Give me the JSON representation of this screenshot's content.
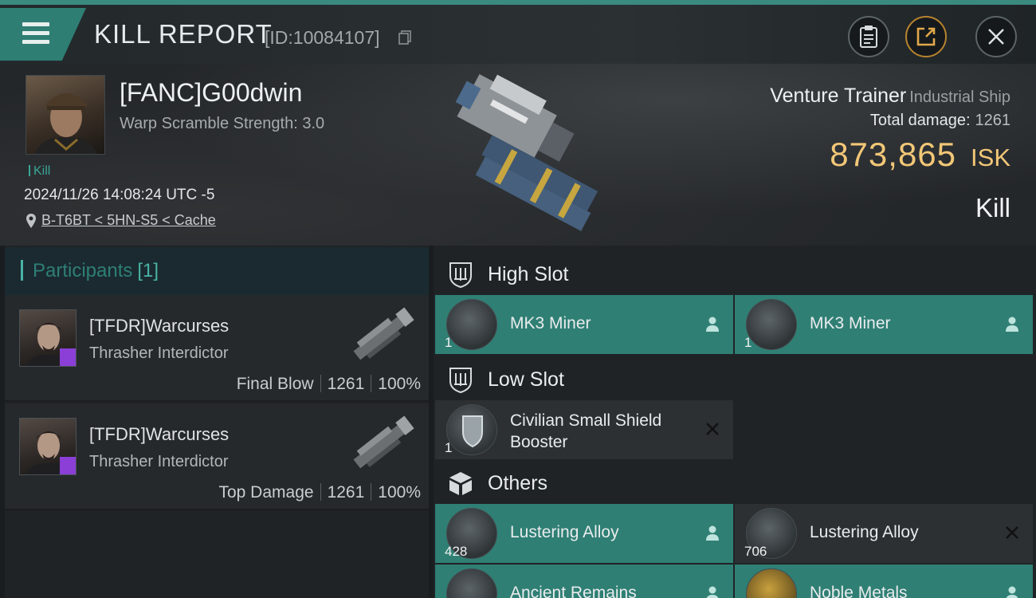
{
  "header": {
    "menu_label": "menu",
    "title": "KILL REPORT",
    "report_id": "[ID:10084107]",
    "icons": [
      "copy-icon",
      "clipboard-icon",
      "share-icon",
      "close-icon"
    ]
  },
  "victim": {
    "name": "[FANC]G00dwin",
    "subtitle": "Warp Scramble Strength: 3.0",
    "kill_tag": "Kill",
    "datetime": "2024/11/26 14:08:24 UTC -5",
    "location": "B-T6BT < 5HN-S5 < Cache"
  },
  "ship": {
    "name": "Venture Trainer",
    "class": "Industrial Ship",
    "total_damage_label": "Total damage:",
    "total_damage": "1261",
    "isk_value": "873,865",
    "isk_unit": "ISK",
    "result": "Kill"
  },
  "participants": {
    "label": "Participants",
    "count": "[1]",
    "rows": [
      {
        "name": "[TFDR]Warcurses",
        "ship": "Thrasher Interdictor",
        "role": "Final Blow",
        "damage": "1261",
        "percent": "100%"
      },
      {
        "name": "[TFDR]Warcurses",
        "ship": "Thrasher Interdictor",
        "role": "Top Damage",
        "damage": "1261",
        "percent": "100%"
      }
    ]
  },
  "slots": {
    "high": {
      "label": "High Slot",
      "items": [
        {
          "name": "MK3 Miner",
          "qty": "1",
          "status": "person-icon"
        },
        {
          "name": "MK3 Miner",
          "qty": "1",
          "status": "person-icon"
        }
      ]
    },
    "low": {
      "label": "Low Slot",
      "items": [
        {
          "name_line1": "Civilian Small Shield",
          "name_line2": "Booster",
          "qty": "1",
          "status": "destroyed-x-icon"
        }
      ]
    },
    "others": {
      "label": "Others",
      "items": [
        {
          "name": "Lustering Alloy",
          "qty": "428",
          "status": "person-icon"
        },
        {
          "name": "Lustering Alloy",
          "qty": "706",
          "status": "destroyed-x-icon"
        },
        {
          "name": "Ancient Remains",
          "qty": "",
          "status": "person-icon"
        },
        {
          "name": "Noble Metals",
          "qty": "",
          "status": "person-icon"
        }
      ]
    }
  },
  "colors": {
    "accent_teal": "#2f7f74",
    "isk_gold": "#f2c777",
    "badge_purple": "#8b3fd6"
  }
}
